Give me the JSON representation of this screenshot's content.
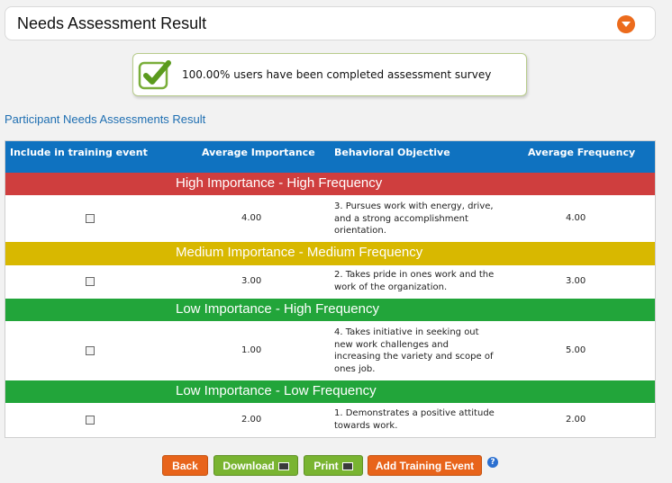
{
  "header": {
    "title": "Needs Assessment Result"
  },
  "notice": {
    "message": "100.00% users have been completed assessment survey"
  },
  "section_title": "Participant Needs Assessments Result",
  "table": {
    "columns": [
      "Include in training event",
      "Average Importance",
      "Behavioral Objective",
      "Average Frequency"
    ],
    "groups": [
      {
        "label": "High Importance - High Frequency",
        "color": "#cf3e3e",
        "row": {
          "importance": "4.00",
          "objective": "3. Pursues work with energy, drive, and a strong accomplishment orientation.",
          "frequency": "4.00"
        }
      },
      {
        "label": "Medium Importance - Medium Frequency",
        "color": "#d8b800",
        "row": {
          "importance": "3.00",
          "objective": "2. Takes pride in ones work and the work of the organization.",
          "frequency": "3.00"
        }
      },
      {
        "label": "Low Importance - High Frequency",
        "color": "#22a53a",
        "row": {
          "importance": "1.00",
          "objective": "4. Takes initiative in seeking out new work challenges and increasing the variety and scope of ones job.",
          "frequency": "5.00"
        }
      },
      {
        "label": "Low Importance - Low Frequency",
        "color": "#22a53a",
        "row": {
          "importance": "2.00",
          "objective": "1. Demonstrates a positive attitude towards work.",
          "frequency": "2.00"
        }
      }
    ]
  },
  "buttons": {
    "back": "Back",
    "download": "Download",
    "print": "Print",
    "add_training": "Add Training Event"
  },
  "help": "?"
}
